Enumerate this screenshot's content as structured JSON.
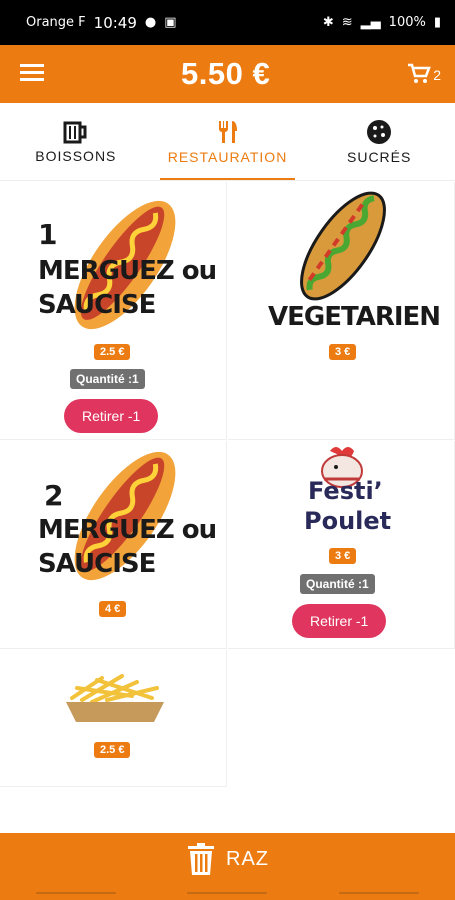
{
  "status": {
    "carrier": "Orange F",
    "time": "10:49",
    "battery": "100%"
  },
  "header": {
    "total": "5.50 €",
    "cart_count": "2"
  },
  "tabs": [
    {
      "label": "BOISSONS",
      "icon": "mug-icon"
    },
    {
      "label": "RESTAURATION",
      "icon": "fork-knife-icon"
    },
    {
      "label": "SUCRÉS",
      "icon": "cookie-icon"
    }
  ],
  "products": [
    {
      "label_num": "1",
      "label_line1": "MERGUEZ ou",
      "label_line2": "SAUCISE",
      "price": "2.5 €",
      "quantity": "Quantité :1",
      "button": "Retirer -1"
    },
    {
      "label_line1": "VEGETARIEN",
      "price": "3 €"
    },
    {
      "label_num": "2",
      "label_line1": "MERGUEZ ou",
      "label_line2": "SAUCISE",
      "price": "4 €"
    },
    {
      "label_line1": "Festi’",
      "label_line2": "Poulet",
      "price": "3 €",
      "quantity": "Quantité :1",
      "button": "Retirer -1"
    },
    {
      "price": "2.5 €"
    }
  ],
  "footer": {
    "label": "RAZ"
  }
}
